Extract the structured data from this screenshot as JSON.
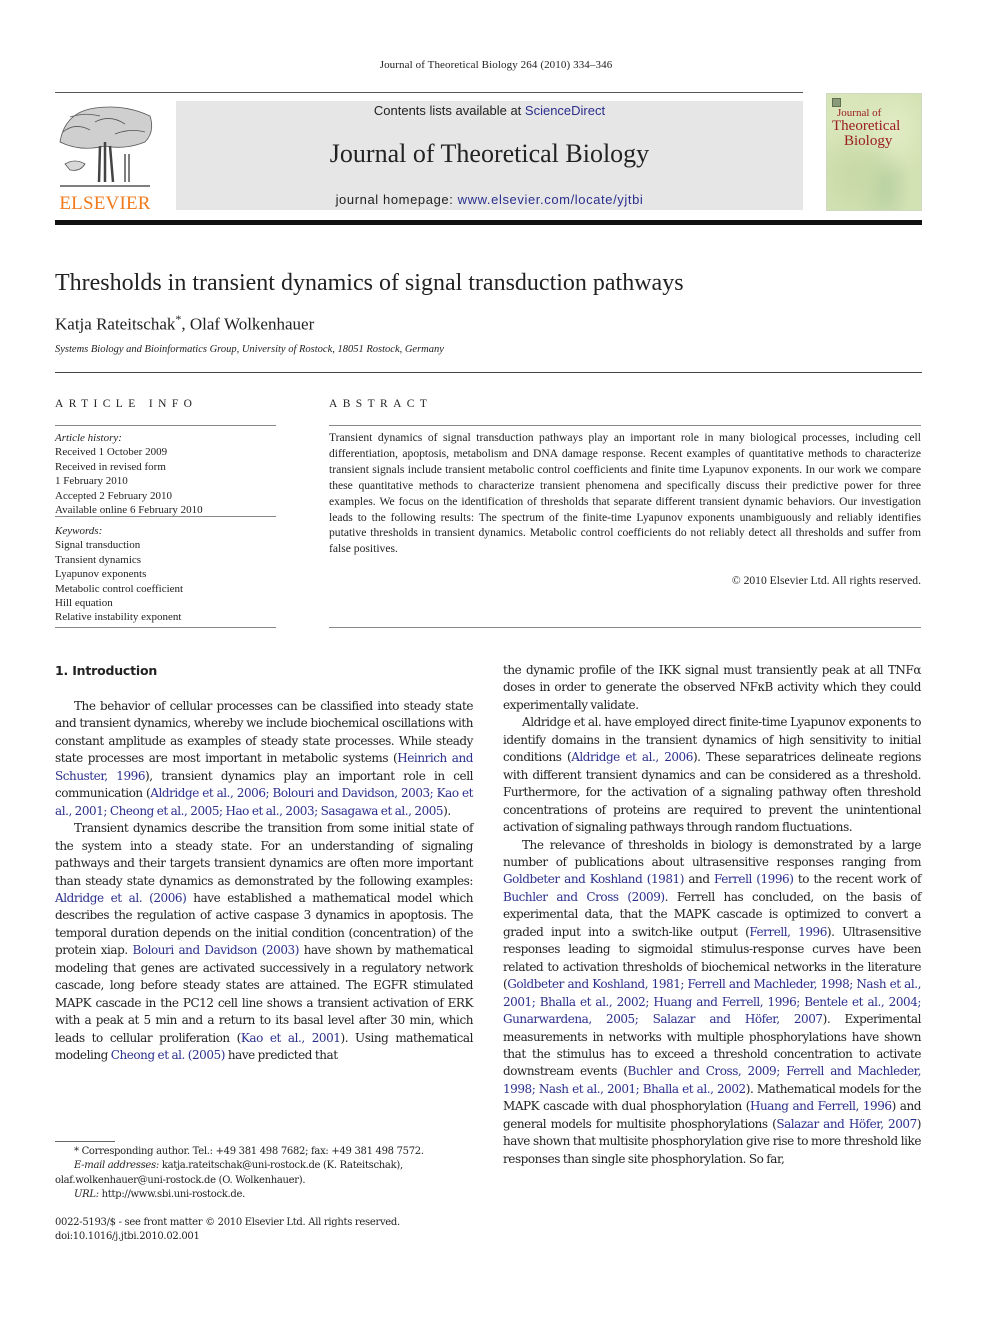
{
  "running_head": "Journal of Theoretical Biology 264 (2010) 334–346",
  "publisher": {
    "logo_word": "ELSEVIER",
    "logo_color": "#f07a1c"
  },
  "masthead": {
    "contents_prefix": "Contents lists available at ",
    "contents_link": "ScienceDirect",
    "journal_title": "Journal of Theoretical Biology",
    "homepage_prefix": "journal homepage: ",
    "homepage_link": "www.elsevier.com/locate/yjtbi",
    "link_color": "#2b2f8c"
  },
  "cover": {
    "line1": "Journal of",
    "line2": "Theoretical",
    "line3": "Biology",
    "title_color": "#9b1d20"
  },
  "article": {
    "title": "Thresholds in transient dynamics of signal transduction pathways",
    "authors": [
      {
        "name": "Katja Rateitschak",
        "mark": "*",
        "sep": ", "
      },
      {
        "name": "Olaf Wolkenhauer",
        "mark": "",
        "sep": ""
      }
    ],
    "affiliation": "Systems Biology and Bioinformatics Group, University of Rostock, 18051 Rostock, Germany"
  },
  "article_info": {
    "heading": "ARTICLE INFO",
    "history_label": "Article history:",
    "history": [
      "Received 1 October 2009",
      "Received in revised form",
      "1 February 2010",
      "Accepted 2 February 2010",
      "Available online 6 February 2010"
    ],
    "keywords_label": "Keywords:",
    "keywords": [
      "Signal transduction",
      "Transient dynamics",
      "Lyapunov exponents",
      "Metabolic control coefficient",
      "Hill equation",
      "Relative instability exponent"
    ]
  },
  "abstract": {
    "heading": "ABSTRACT",
    "text": "Transient dynamics of signal transduction pathways play an important role in many biological processes, including cell differentiation, apoptosis, metabolism and DNA damage response. Recent examples of quantitative methods to characterize transient signals include transient metabolic control coefficients and finite time Lyapunov exponents. In our work we compare these quantitative methods to characterize transient phenomena and specifically discuss their predictive power for three examples. We focus on the identification of thresholds that separate different transient dynamic behaviors. Our investigation leads to the following results: The spectrum of the finite-time Lyapunov exponents unambiguously and reliably identifies putative thresholds in transient dynamics. Metabolic control coefficients do not reliably detect all thresholds and suffer from false positives.",
    "copyright": "© 2010 Elsevier Ltd. All rights reserved."
  },
  "intro": {
    "heading": "1.  Introduction",
    "left_paragraphs": [
      [
        {
          "t": "The behavior of cellular processes can be classified into steady state and transient dynamics, whereby we include biochemical oscillations with constant amplitude as examples of steady state processes. While steady state processes are most important in metabolic systems ("
        },
        {
          "l": "Heinrich and Schuster, 1996"
        },
        {
          "t": "), transient dynamics play an important role in cell communication ("
        },
        {
          "l": "Aldridge et al., 2006; Bolouri and Davidson, 2003; Kao et al., 2001; Cheong et al., 2005; Hao et al., 2003; Sasagawa et al., 2005"
        },
        {
          "t": ")."
        }
      ],
      [
        {
          "t": "Transient dynamics describe the transition from some initial state of the system into a steady state. For an understanding of signaling pathways and their targets transient dynamics are often more important than steady state dynamics as demonstrated by the following examples: "
        },
        {
          "l": "Aldridge et al. (2006)"
        },
        {
          "t": " have established a mathematical model which describes the regulation of active caspase 3 dynamics in apoptosis. The temporal duration depends on the initial condition (concentration) of the protein xiap. "
        },
        {
          "l": "Bolouri and Davidson (2003)"
        },
        {
          "t": " have shown by mathematical modeling that genes are activated successively in a regulatory network cascade, long before steady states are attained. The EGFR stimulated MAPK cascade in the PC12 cell line shows a transient activation of ERK with a peak at 5 min and a return to its basal level after 30 min, which leads to cellular proliferation ("
        },
        {
          "l": "Kao et al., 2001"
        },
        {
          "t": "). Using mathematical modeling "
        },
        {
          "l": "Cheong et al. (2005)"
        },
        {
          "t": " have predicted that"
        }
      ]
    ],
    "right_paragraphs": [
      [
        {
          "t": "the dynamic profile of the IKK signal must transiently peak at all TNFα doses in order to generate the observed NFκB activity which they could experimentally validate."
        }
      ],
      [
        {
          "t": "Aldridge et al. have employed direct finite-time Lyapunov exponents to identify domains in the transient dynamics of high sensitivity to initial conditions ("
        },
        {
          "l": "Aldridge et al., 2006"
        },
        {
          "t": "). These separatrices delineate regions with different transient dynamics and can be considered as a threshold. Furthermore, for the activation of a signaling pathway often threshold concentrations of proteins are required to prevent the unintentional activation of signaling pathways through random fluctuations."
        }
      ],
      [
        {
          "t": "The relevance of thresholds in biology is demonstrated by a large number of publications about ultrasensitive responses ranging from "
        },
        {
          "l": "Goldbeter and Koshland (1981)"
        },
        {
          "t": " and "
        },
        {
          "l": "Ferrell (1996)"
        },
        {
          "t": " to the recent work of "
        },
        {
          "l": "Buchler and Cross (2009)"
        },
        {
          "t": ". Ferrell has concluded, on the basis of experimental data, that the MAPK cascade is optimized to convert a graded input into a switch-like output ("
        },
        {
          "l": "Ferrell, 1996"
        },
        {
          "t": "). Ultrasensitive responses leading to sigmoidal stimulus-response curves have been related to activation thresholds of biochemical networks in the literature ("
        },
        {
          "l": "Goldbeter and Koshland, 1981; Ferrell and Machleder, 1998; Nash et al., 2001; Bhalla et al., 2002; Huang and Ferrell, 1996; Bentele et al., 2004; Gunarwardena, 2005; Salazar and Höfer, 2007"
        },
        {
          "t": "). Experimental measurements in networks with multiple phosphorylations have shown that the stimulus has to exceed a threshold concentration to activate downstream events ("
        },
        {
          "l": "Buchler and Cross, 2009; Ferrell and Machleder, 1998; Nash et al., 2001; Bhalla et al., 2002"
        },
        {
          "t": "). Mathematical models for the MAPK cascade with dual phosphorylation ("
        },
        {
          "l": "Huang and Ferrell, 1996"
        },
        {
          "t": ") and general models for multisite phosphorylations ("
        },
        {
          "l": "Salazar and Höfer, 2007"
        },
        {
          "t": ") have shown that multisite phosphorylation give rise to more threshold like responses than single site phosphorylation. So far,"
        }
      ]
    ]
  },
  "footnotes": {
    "corresponding": "* Corresponding author. Tel.: +49 381 498 7682; fax: +49 381 498 7572.",
    "email_label": "E-mail addresses:",
    "email_text1": " katja.rateitschak@uni-rostock.de (K. Rateitschak),",
    "email_text2": "olaf.wolkenhauer@uni-rostock.de (O. Wolkenhauer).",
    "url_label": "URL:",
    "url_text": " http://www.sbi.uni-rostock.de.",
    "issn_line": "0022-5193/$ - see front matter © 2010 Elsevier Ltd. All rights reserved.",
    "doi_line": "doi:10.1016/j.jtbi.2010.02.001"
  }
}
